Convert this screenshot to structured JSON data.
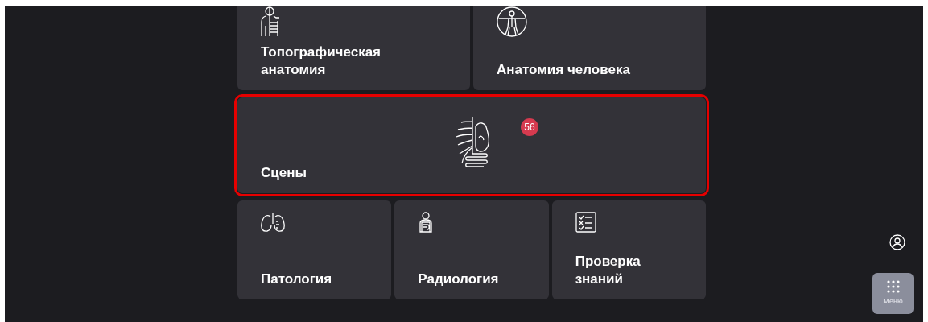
{
  "tile_rows": [
    {
      "tiles": [
        {
          "label": "Топографическая анатомия",
          "selected": false
        },
        {
          "label": "Анатомия человека",
          "selected": false
        }
      ]
    },
    {
      "tiles": [
        {
          "label": "Сцены",
          "badge": "56",
          "selected": true
        }
      ]
    },
    {
      "tiles": [
        {
          "label": "Патология",
          "selected": false
        },
        {
          "label": "Радиология",
          "selected": false
        },
        {
          "label": "Проверка знаний",
          "selected": false
        }
      ]
    }
  ],
  "menu_button": {
    "label": "Меню"
  }
}
